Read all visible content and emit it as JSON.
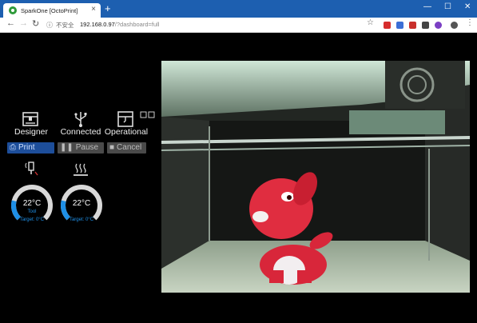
{
  "browser": {
    "tab_title": "SparkOne [OctoPrint]",
    "tab_close": "×",
    "new_tab": "+",
    "security_label": "不安全",
    "url_host": "192.168.0.97",
    "url_path": "/?dashboard=full",
    "window_controls": [
      "—",
      "☐",
      "✕"
    ],
    "icons": [
      "back-icon",
      "forward-icon",
      "reload-icon",
      "info-icon",
      "star-icon",
      "menu-icon"
    ]
  },
  "printer": {
    "profile_label": "Designer",
    "connection_label": "Connected",
    "state_label": "Operational",
    "buttons": {
      "print": "Print",
      "pause": "Pause",
      "cancel": "Cancel"
    },
    "tool": {
      "temp": "22°C",
      "name": "Tool",
      "target": "Target: 0°C",
      "level": 0.22
    },
    "bed": {
      "temp": "22°C",
      "target": "Target: 0°C",
      "level": 0.22
    }
  },
  "colors": {
    "accent": "#1e8fe6",
    "print_button": "#1d4e9a",
    "titlebar": "#1d5fb0"
  }
}
